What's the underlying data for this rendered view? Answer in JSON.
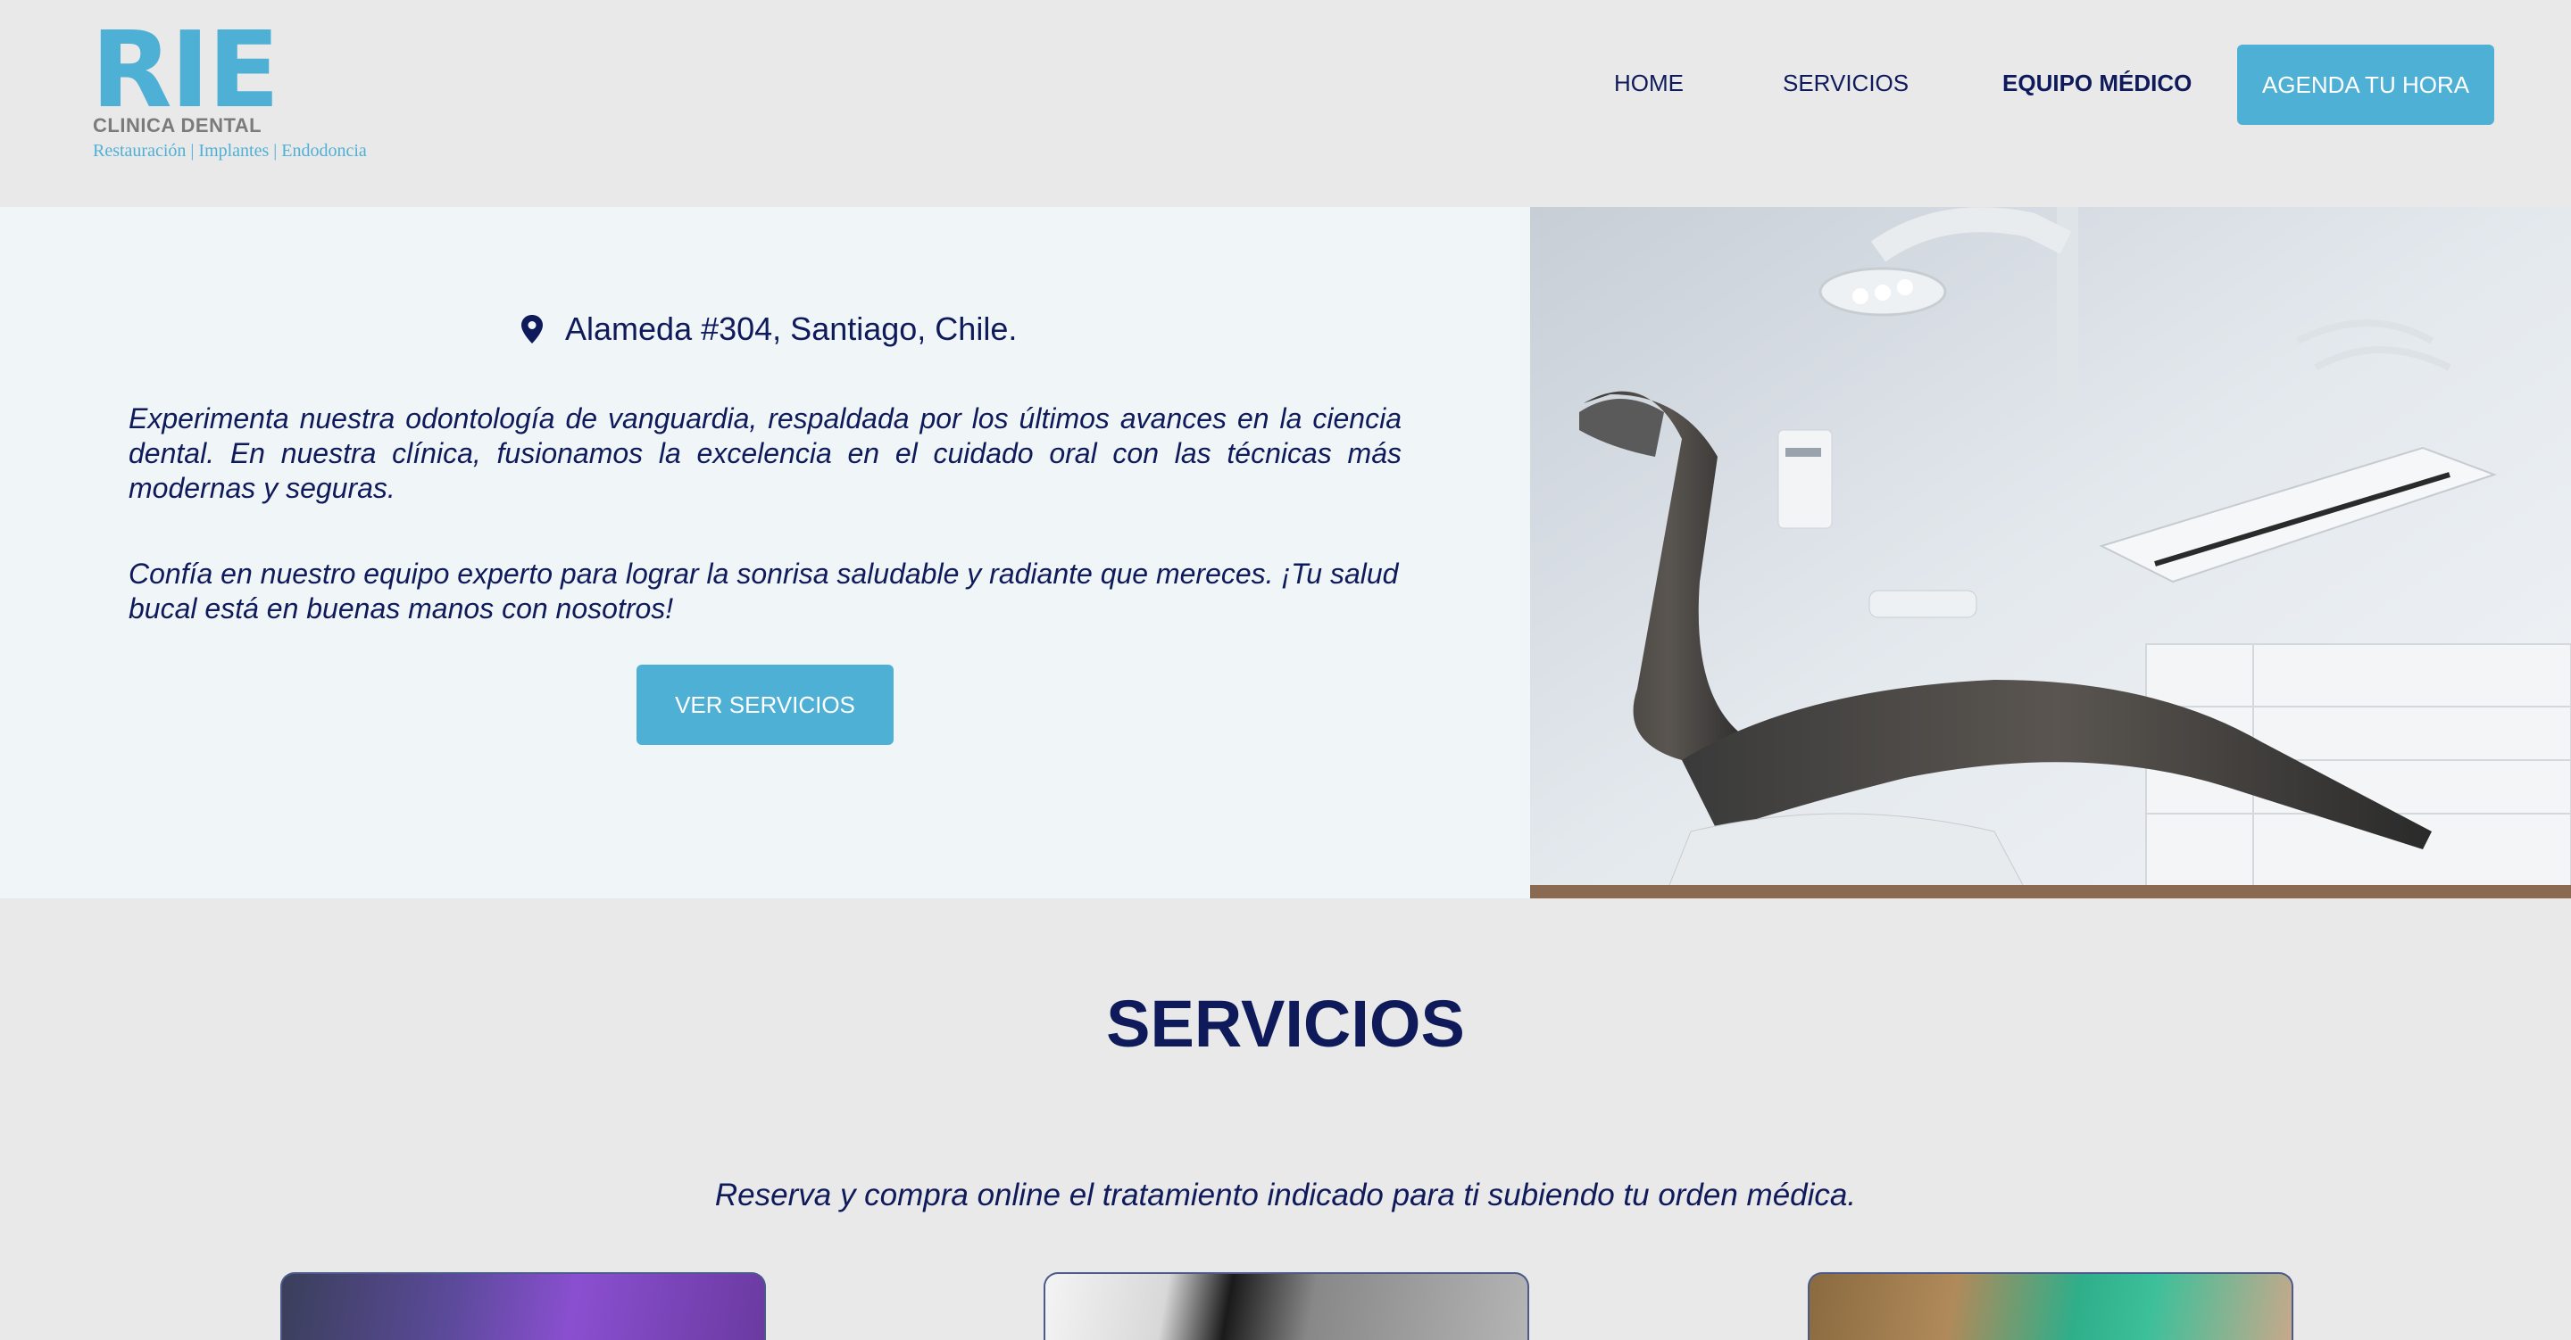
{
  "brand": {
    "logo_mark": "RIE",
    "logo_sub": "CLINICA DENTAL",
    "logo_tagline": "Restauración | Implantes | Endodoncia",
    "accent": "#4fb0d5",
    "navy": "#0f1a5a"
  },
  "nav": {
    "home": "HOME",
    "services": "SERVICIOS",
    "team": "EQUIPO MÉDICO",
    "cta": "AGENDA TU HORA"
  },
  "hero": {
    "pin_icon": "location-pin-icon",
    "address": "Alameda #304, Santiago, Chile.",
    "paragraph1": "Experimenta nuestra odontología de vanguardia, respaldada por los últimos avances en la ciencia dental. En nuestra clínica, fusionamos la excelencia en el cuidado oral con las técnicas más modernas y seguras.",
    "paragraph2": "Confía en nuestro equipo experto para lograr la sonrisa saludable y radiante que mereces. ¡Tu salud bucal está en buenas manos con nosotros!",
    "button": "VER SERVICIOS",
    "image": "dental-chair-photo"
  },
  "services": {
    "title": "SERVICIOS",
    "subtitle": "Reserva y compra online el tratamiento indicado para ti subiendo tu orden médica.",
    "cards": [
      "service-card-dental-tools",
      "service-card-dental-lamp",
      "service-card-dentist-hands"
    ]
  }
}
